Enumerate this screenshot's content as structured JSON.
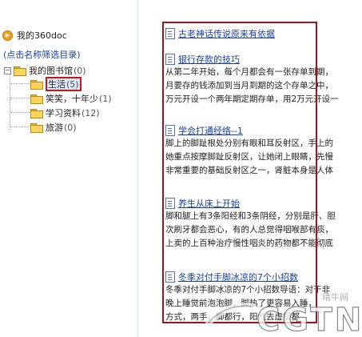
{
  "sidebar": {
    "home_label": "我的360doc",
    "hint": "(点击名称筛选目录)",
    "root": {
      "label": "我的图书馆",
      "count": "(0)"
    },
    "children": [
      {
        "label": "生活",
        "count": "(5)",
        "selected": true
      },
      {
        "label": "笑笑，十年少",
        "count": "(1)"
      },
      {
        "label": "学习资料",
        "count": "(12)"
      },
      {
        "label": "旅游",
        "count": "(0)"
      }
    ]
  },
  "articles": [
    {
      "title": "古老神话传说原来有依据",
      "lines": []
    },
    {
      "title": "银行存款的技巧",
      "lines": [
        "从第二年开始，每个月都会有一张存单到期，",
        "月要存的钱添加到当月到期的这个存单之中，",
        "万元开设一个两年期定期存单，用2万元开设一"
      ]
    },
    {
      "title": "学会打通经络--1",
      "lines": [
        "脚上的脚趾根处分别有眼和耳反射区，手上的",
        "她重点按摩脚趾反射区，让她闭上眼睛，先慢",
        "非常重要的基础反射区之一，肾脏本身是人体"
      ]
    },
    {
      "title": "养生从床上开始",
      "lines": [
        "脚和腿上有3条阳经和3条阴经，分别是肝、胆",
        "次刷牙都会恶心，有的人总觉得咽喉部有痰，",
        "上卖的上百种治疗慢性咽炎的药物都不能彻底"
      ]
    },
    {
      "title": "冬季对付手脚冰凉的7个小招数",
      "lines": [
        "冬季对付手脚冰凉的7个小招数导语：对于非",
        "晚上睡觉前泡泡脚，脚热了更容易入睡，",
        "方式，两手，脚都行，阳气去虚损都"
      ]
    }
  ],
  "watermark": {
    "text": "CGTN",
    "sub": "晴牛网"
  },
  "colors": {
    "selection_border": "#c0181c",
    "frame": "#a3131c",
    "link": "#1a3fa6"
  }
}
